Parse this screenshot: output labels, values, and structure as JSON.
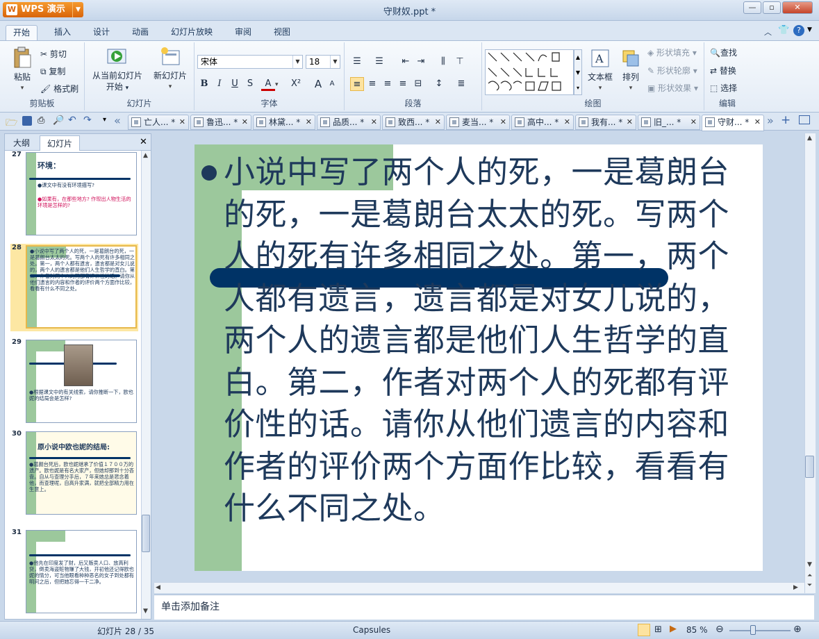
{
  "app": {
    "name": "WPS 演示",
    "doc_title": "守财奴.ppt *"
  },
  "ribbon_tabs": [
    "开始",
    "插入",
    "设计",
    "动画",
    "幻灯片放映",
    "审阅",
    "视图"
  ],
  "clipboard": {
    "paste": "粘贴",
    "cut": "剪切",
    "copy": "复制",
    "format_painter": "格式刷",
    "group": "剪贴板"
  },
  "slides_group": {
    "from_current": "从当前幻灯片",
    "start": "开始",
    "new_slide": "新幻灯片",
    "group": "幻灯片"
  },
  "font": {
    "name": "宋体",
    "size": "18",
    "bold": "B",
    "italic": "I",
    "underline": "U",
    "shadow": "S",
    "color": "A",
    "superscript": "X²",
    "grow": "A",
    "shrink": "A",
    "group": "字体"
  },
  "paragraph": {
    "group": "段落"
  },
  "drawing": {
    "textbox": "文本框",
    "arrange": "排列",
    "shape_fill": "形状填充",
    "shape_outline": "形状轮廓",
    "shape_effect": "形状效果",
    "group": "绘图"
  },
  "editing": {
    "find": "查找",
    "replace": "替换",
    "select": "选择",
    "group": "编辑"
  },
  "doc_tabs": [
    "亡人... *",
    "鲁迅... *",
    "林黛... *",
    "品质... *",
    "致西... *",
    "麦当... *",
    "高中... *",
    "我有... *",
    "旧_... *",
    "守财... *"
  ],
  "panel": {
    "tab_outline": "大纲",
    "tab_slides": "幻灯片"
  },
  "thumbs": [
    {
      "num": "27",
      "title": "环境：",
      "lines": [
        "●课文中有没有环境描写?",
        "●如果有，在那些地方? 作现出人物生活的环境是怎样的?"
      ]
    },
    {
      "num": "28",
      "text": "●小说中写了两个人的死，一是葛朗台的死，一是葛朗台太太的死。写两个人的死有许多相同之处。第一，两个人都有遗言，遗言都是对女儿说的，两个人的遗言都是他们人生哲学的直白。第二，作者对两个人的死都有评价性的话。请你从他们遗言的内容和作者的评价两个方面作比较，看看有什么不同之处。"
    },
    {
      "num": "29",
      "text": "●根据课文中的有关线索，请你推断一下，欧也妮的结局会是怎样?"
    },
    {
      "num": "30",
      "title": "原小说中欧也妮的结局:",
      "text": "●葛朗台死后，欧也妮继承了价值１７００万的遗产。欧也妮是有名大家产，但她却那到十分吝啬。自从与查理分手后，７年来她总是悲念着他，而查理呢，自高升家满，就把全部精力用在生意上。"
    },
    {
      "num": "31",
      "text": "●他先在印度发了财，后又贩卖人口、放高利贷，倒卖海盗赃物赚了大钱，开初他还记得欧也妮的情分，可当他眼看种种恶名的女子到处都有明问之后，但把她忘得一干二净。"
    }
  ],
  "slide": {
    "text": "小说中写了两个人的死，一是葛朗台的死，一是葛朗台太太的死。写两个人的死有许多相同之处。第一，两个人都有遗言，遗言都是对女儿说的，两个人的遗言都是他们人生哲学的直白。第二，作者对两个人的死都有评价性的话。请你从他们遗言的内容和作者的评价两个方面作比较，看看有什么不同之处。"
  },
  "notes": {
    "placeholder": "单击添加备注"
  },
  "status": {
    "slide_pos": "幻灯片 28 / 35",
    "theme": "Capsules",
    "zoom": "85 %"
  }
}
